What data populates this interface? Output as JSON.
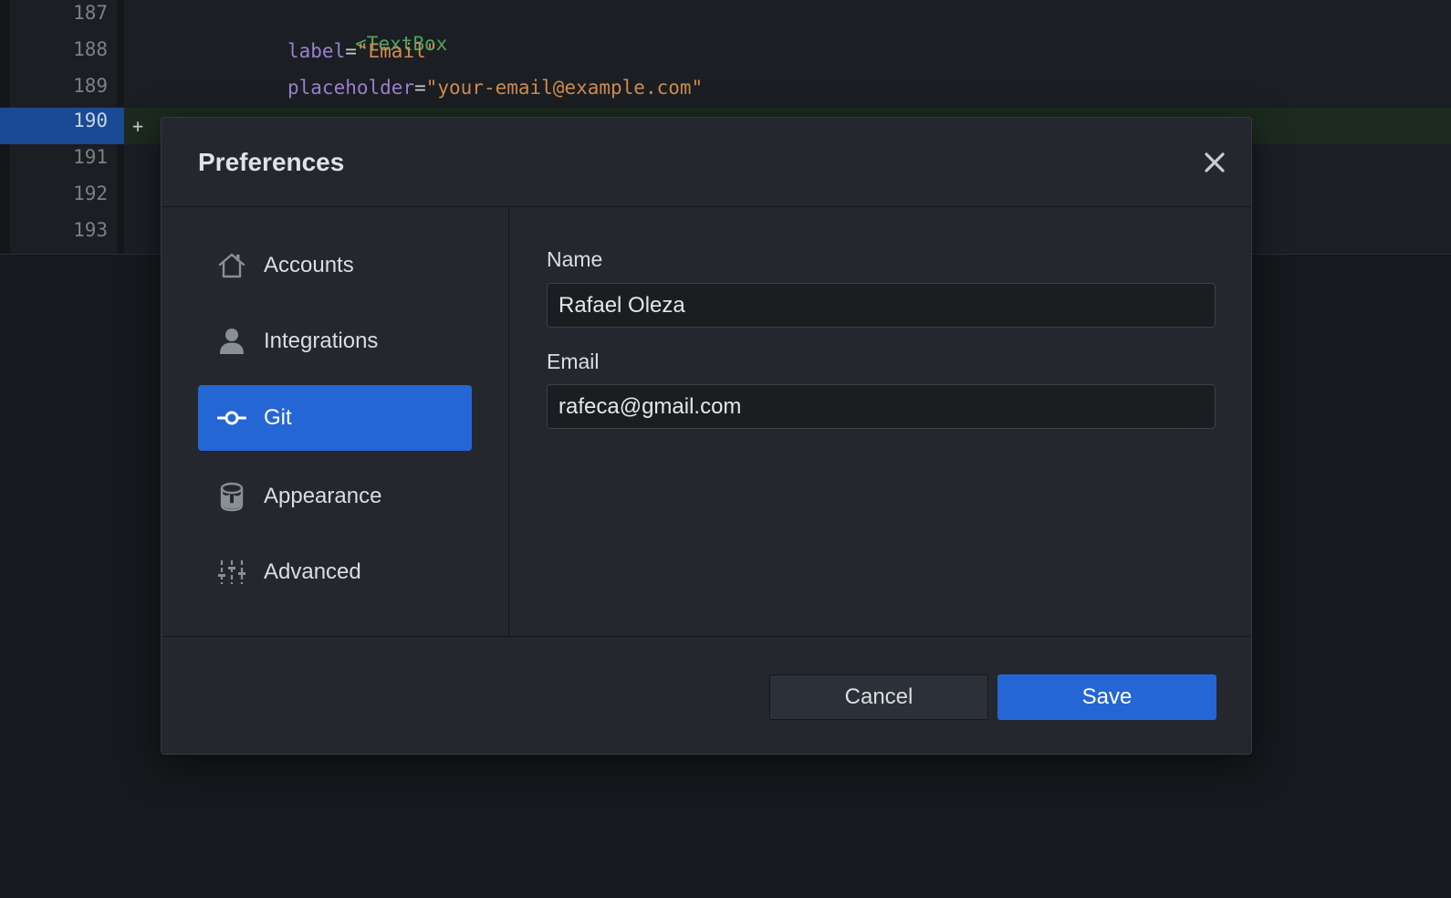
{
  "editor": {
    "lines": [
      {
        "number": "187",
        "code": [
          {
            "cls": "tok-tag",
            "text": "<TextBox"
          }
        ]
      },
      {
        "number": "188",
        "code": [
          {
            "cls": "tok-attr",
            "text": "label"
          },
          {
            "cls": "tok-eq",
            "text": "="
          },
          {
            "cls": "tok-str",
            "text": "\"Email\""
          }
        ]
      },
      {
        "number": "189",
        "code": [
          {
            "cls": "tok-attr",
            "text": "placeholder"
          },
          {
            "cls": "tok-eq",
            "text": "="
          },
          {
            "cls": "tok-str",
            "text": "\"your-email@example.com\""
          }
        ]
      },
      {
        "number": "190",
        "added": true,
        "marker": "+",
        "code": []
      },
      {
        "number": "191",
        "code": []
      },
      {
        "number": "192",
        "code": []
      },
      {
        "number": "193",
        "code": []
      }
    ]
  },
  "dialog": {
    "title": "Preferences",
    "close_icon": "close-icon",
    "nav": {
      "items": [
        {
          "label": "Accounts",
          "icon": "home-icon",
          "active": false
        },
        {
          "label": "Integrations",
          "icon": "person-icon",
          "active": false
        },
        {
          "label": "Git",
          "icon": "git-commit-icon",
          "active": true
        },
        {
          "label": "Appearance",
          "icon": "paint-bucket-icon",
          "active": false
        },
        {
          "label": "Advanced",
          "icon": "sliders-icon",
          "active": false
        }
      ]
    },
    "form": {
      "name_label": "Name",
      "name_value": "Rafael Oleza",
      "email_label": "Email",
      "email_value": "rafeca@gmail.com"
    },
    "footer": {
      "cancel_label": "Cancel",
      "save_label": "Save"
    }
  },
  "colors": {
    "accent": "#2466d4",
    "added_line_bg": "#1c2a1f",
    "line_number_highlight": "#1a4a94",
    "tag": "#4fa45a",
    "attribute": "#9b7fd0",
    "string": "#d08b4f"
  }
}
